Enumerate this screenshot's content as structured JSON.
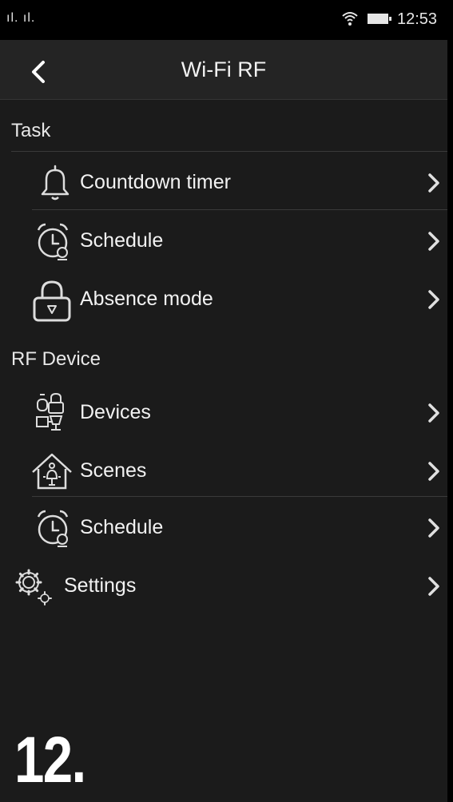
{
  "status_bar": {
    "signal": "ıl. ıl.",
    "time": "12:53"
  },
  "header": {
    "title": "Wi-Fi RF"
  },
  "sections": {
    "task": "Task",
    "rf_device": "RF Device"
  },
  "items": [
    {
      "label": "Countdown timer",
      "icon": "bell-icon"
    },
    {
      "label": "Schedule",
      "icon": "alarm-clock-icon"
    },
    {
      "label": "Absence mode",
      "icon": "padlock-icon"
    },
    {
      "label": "Devices",
      "icon": "devices-icon"
    },
    {
      "label": "Scenes",
      "icon": "scene-house-icon"
    },
    {
      "label": "Schedule",
      "icon": "alarm-clock-icon"
    },
    {
      "label": "Settings",
      "icon": "gear-icon"
    }
  ],
  "step_number": "12.",
  "colors": {
    "background": "#1b1b1b",
    "app_bar": "#242424",
    "text": "#f2f2f2",
    "divider": "#3a3a3a"
  }
}
